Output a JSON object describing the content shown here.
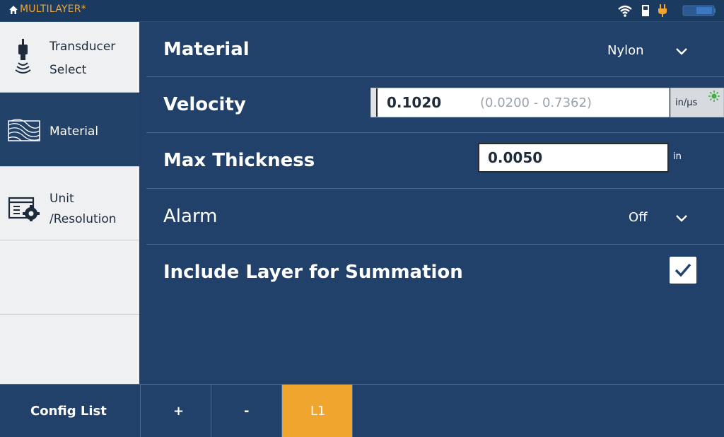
{
  "header": {
    "title": "MULTILAYER*"
  },
  "status_icons": [
    "wifi-icon",
    "usb-icon",
    "power-plug-icon",
    "battery-icon"
  ],
  "sidebar": {
    "items": [
      {
        "label_line1": "Transducer",
        "label_line2": "Select",
        "icon": "transducer-icon"
      },
      {
        "label_line1": "Material",
        "icon": "material-icon"
      },
      {
        "label_line1": "Unit",
        "label_line2": "/Resolution",
        "icon": "unit-settings-icon"
      }
    ]
  },
  "main": {
    "material": {
      "label": "Material",
      "value": "Nylon"
    },
    "velocity": {
      "label": "Velocity",
      "value": "0.1020",
      "range": "(0.0200 - 0.7362)",
      "unit": "in/μs"
    },
    "max_thickness": {
      "label": "Max Thickness",
      "value": "0.0050",
      "unit": "in"
    },
    "alarm": {
      "label": "Alarm",
      "value": "Off"
    },
    "summation": {
      "label": "Include Layer for Summation",
      "checked": true
    }
  },
  "footer": {
    "config_list": "Config List",
    "add": "+",
    "remove": "-",
    "layer": "L1"
  },
  "colors": {
    "accent_orange": "#f0a52f",
    "panel_blue": "#21416a",
    "sidebar_bg": "#eef0f2"
  }
}
